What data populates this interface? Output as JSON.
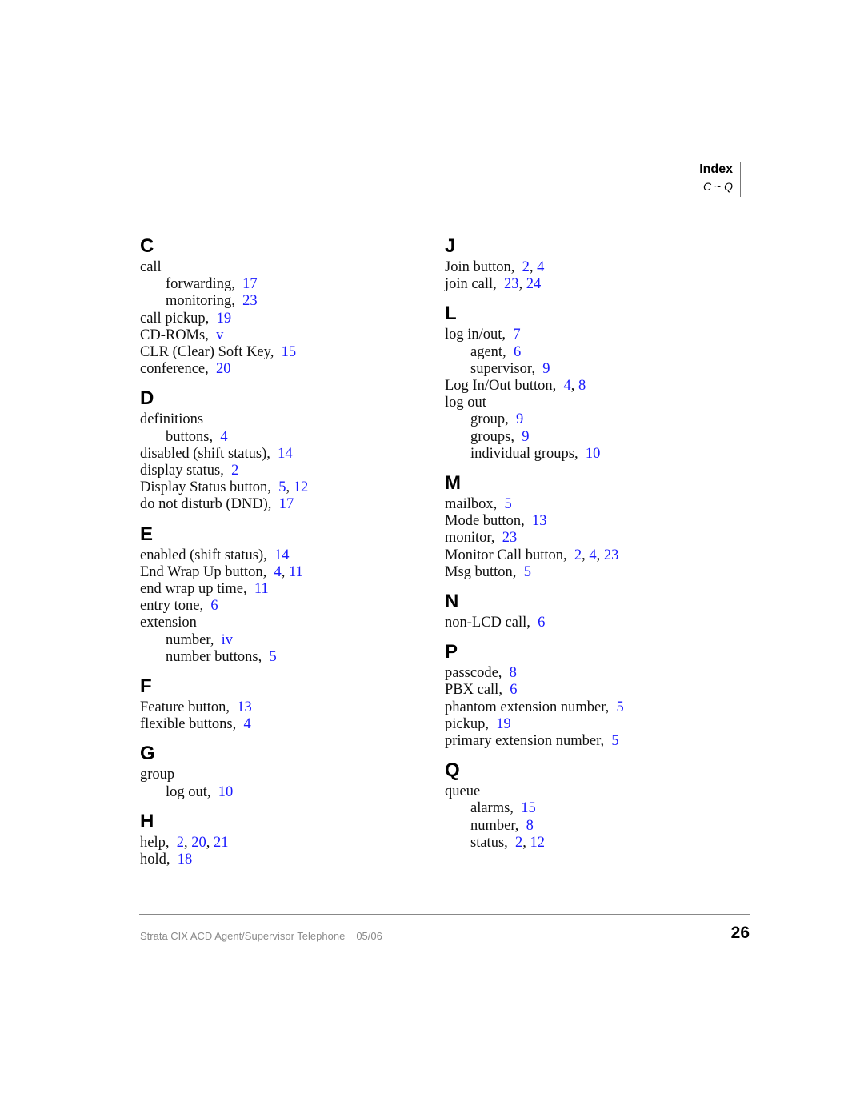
{
  "header": {
    "title": "Index",
    "range": "C ~ Q"
  },
  "theme": {
    "link_color": "#1a1aff"
  },
  "columns": [
    {
      "sections": [
        {
          "letter": "C",
          "entries": [
            {
              "term": "call",
              "pages": [],
              "sub": false
            },
            {
              "term": "forwarding,",
              "pages": [
                "17"
              ],
              "sub": true
            },
            {
              "term": "monitoring,",
              "pages": [
                "23"
              ],
              "sub": true
            },
            {
              "term": "call pickup,",
              "pages": [
                "19"
              ],
              "sub": false
            },
            {
              "term": "CD-ROMs,",
              "pages": [
                "v"
              ],
              "sub": false
            },
            {
              "term": "CLR (Clear) Soft Key,",
              "pages": [
                "15"
              ],
              "sub": false
            },
            {
              "term": "conference,",
              "pages": [
                "20"
              ],
              "sub": false
            }
          ]
        },
        {
          "letter": "D",
          "entries": [
            {
              "term": "definitions",
              "pages": [],
              "sub": false
            },
            {
              "term": "buttons,",
              "pages": [
                "4"
              ],
              "sub": true
            },
            {
              "term": "disabled (shift status),",
              "pages": [
                "14"
              ],
              "sub": false
            },
            {
              "term": "display status,",
              "pages": [
                "2"
              ],
              "sub": false
            },
            {
              "term": "Display Status button,",
              "pages": [
                "5",
                "12"
              ],
              "sub": false
            },
            {
              "term": "do not disturb (DND),",
              "pages": [
                "17"
              ],
              "sub": false
            }
          ]
        },
        {
          "letter": "E",
          "entries": [
            {
              "term": "enabled (shift status),",
              "pages": [
                "14"
              ],
              "sub": false
            },
            {
              "term": "End Wrap Up button,",
              "pages": [
                "4",
                "11"
              ],
              "sub": false
            },
            {
              "term": "end wrap up time,",
              "pages": [
                "11"
              ],
              "sub": false
            },
            {
              "term": "entry tone,",
              "pages": [
                "6"
              ],
              "sub": false
            },
            {
              "term": "extension",
              "pages": [],
              "sub": false
            },
            {
              "term": "number,",
              "pages": [
                "iv"
              ],
              "sub": true
            },
            {
              "term": "number buttons,",
              "pages": [
                "5"
              ],
              "sub": true
            }
          ]
        },
        {
          "letter": "F",
          "entries": [
            {
              "term": "Feature button,",
              "pages": [
                "13"
              ],
              "sub": false
            },
            {
              "term": "flexible buttons,",
              "pages": [
                "4"
              ],
              "sub": false
            }
          ]
        },
        {
          "letter": "G",
          "entries": [
            {
              "term": "group",
              "pages": [],
              "sub": false
            },
            {
              "term": "log out,",
              "pages": [
                "10"
              ],
              "sub": true
            }
          ]
        },
        {
          "letter": "H",
          "entries": [
            {
              "term": "help,",
              "pages": [
                "2",
                "20",
                "21"
              ],
              "sub": false
            },
            {
              "term": "hold,",
              "pages": [
                "18"
              ],
              "sub": false
            }
          ]
        }
      ]
    },
    {
      "sections": [
        {
          "letter": "J",
          "entries": [
            {
              "term": "Join button,",
              "pages": [
                "2",
                "4"
              ],
              "sub": false
            },
            {
              "term": "join call,",
              "pages": [
                "23",
                "24"
              ],
              "sub": false
            }
          ]
        },
        {
          "letter": "L",
          "entries": [
            {
              "term": "log in/out,",
              "pages": [
                "7"
              ],
              "sub": false
            },
            {
              "term": "agent,",
              "pages": [
                "6"
              ],
              "sub": true
            },
            {
              "term": "supervisor,",
              "pages": [
                "9"
              ],
              "sub": true
            },
            {
              "term": "Log In/Out button,",
              "pages": [
                "4",
                "8"
              ],
              "sub": false
            },
            {
              "term": "log out",
              "pages": [],
              "sub": false
            },
            {
              "term": "group,",
              "pages": [
                "9"
              ],
              "sub": true
            },
            {
              "term": "groups,",
              "pages": [
                "9"
              ],
              "sub": true
            },
            {
              "term": "individual groups,",
              "pages": [
                "10"
              ],
              "sub": true
            }
          ]
        },
        {
          "letter": "M",
          "entries": [
            {
              "term": "mailbox,",
              "pages": [
                "5"
              ],
              "sub": false
            },
            {
              "term": "Mode button,",
              "pages": [
                "13"
              ],
              "sub": false
            },
            {
              "term": "monitor,",
              "pages": [
                "23"
              ],
              "sub": false
            },
            {
              "term": "Monitor Call button,",
              "pages": [
                "2",
                "4",
                "23"
              ],
              "sub": false
            },
            {
              "term": "Msg button,",
              "pages": [
                "5"
              ],
              "sub": false
            }
          ]
        },
        {
          "letter": "N",
          "entries": [
            {
              "term": "non-LCD call,",
              "pages": [
                "6"
              ],
              "sub": false
            }
          ]
        },
        {
          "letter": "P",
          "entries": [
            {
              "term": "passcode,",
              "pages": [
                "8"
              ],
              "sub": false
            },
            {
              "term": "PBX call,",
              "pages": [
                "6"
              ],
              "sub": false
            },
            {
              "term": "phantom extension number,",
              "pages": [
                "5"
              ],
              "sub": false
            },
            {
              "term": "pickup,",
              "pages": [
                "19"
              ],
              "sub": false
            },
            {
              "term": "primary extension number,",
              "pages": [
                "5"
              ],
              "sub": false
            }
          ]
        },
        {
          "letter": "Q",
          "entries": [
            {
              "term": "queue",
              "pages": [],
              "sub": false
            },
            {
              "term": "alarms,",
              "pages": [
                "15"
              ],
              "sub": true
            },
            {
              "term": "number,",
              "pages": [
                "8"
              ],
              "sub": true
            },
            {
              "term": "status,",
              "pages": [
                "2",
                "12"
              ],
              "sub": true
            }
          ]
        }
      ]
    }
  ],
  "footer": {
    "title": "Strata CIX ACD Agent/Supervisor Telephone",
    "date": "05/06",
    "page_number": "26"
  }
}
